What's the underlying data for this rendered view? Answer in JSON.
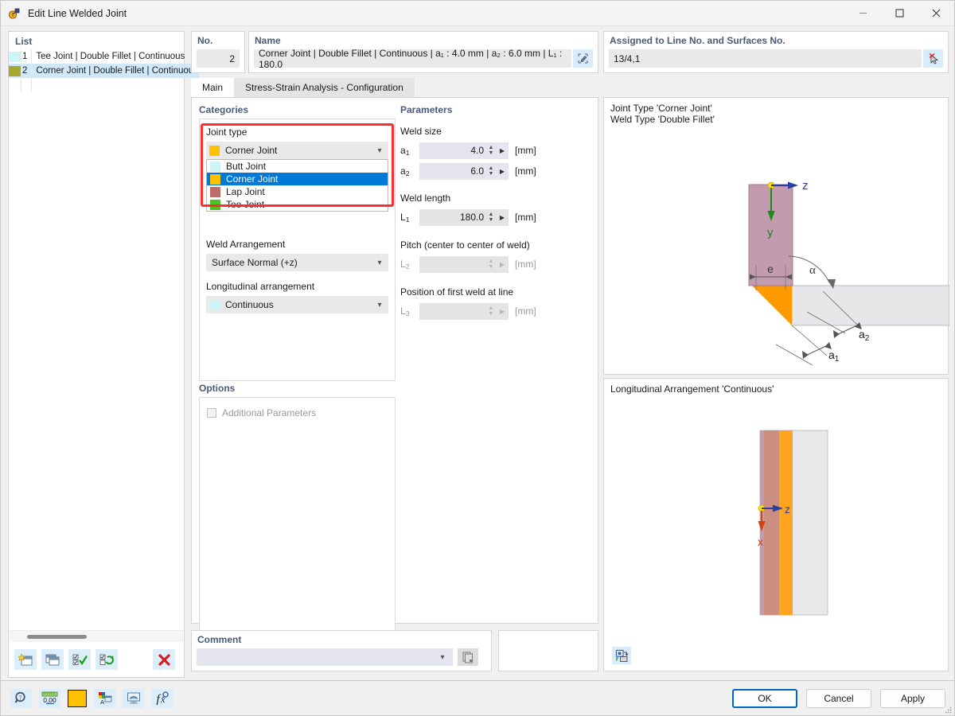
{
  "window": {
    "title": "Edit Line Welded Joint",
    "app_icon": "welded-joint-icon",
    "minimize": "–",
    "maximize": "☐",
    "close": "✕"
  },
  "list_panel": {
    "caption": "List",
    "rows": [
      {
        "color": "#cdf4f7",
        "no": "1",
        "desc": "Tee Joint | Double Fillet | Continuous",
        "selected": false
      },
      {
        "color": "#a5a82e",
        "no": "2",
        "desc": "Corner Joint | Double Fillet | Continuous",
        "selected": true
      }
    ],
    "toolbar": [
      {
        "name": "new-item-button",
        "icon": "new-window-icon"
      },
      {
        "name": "copy-item-button",
        "icon": "copy-window-icon"
      },
      {
        "name": "select-all-button",
        "icon": "check-all-icon"
      },
      {
        "name": "invert-selection-button",
        "icon": "refresh-check-icon"
      },
      {
        "name": "delete-item-button",
        "icon": "red-x-icon"
      }
    ]
  },
  "header": {
    "no_label": "No.",
    "no_value": "2",
    "name_label": "Name",
    "name_value": "Corner Joint | Double Fillet | Continuous | a₁ : 4.0 mm | a₂ : 6.0 mm | L₁ : 180.0",
    "name_edit_icon": "edit-pencil-icon",
    "assigned_label": "Assigned to Line No. and Surfaces No.",
    "assigned_value": "13/4,1",
    "assigned_pick_icon": "pick-cursor-icon"
  },
  "tabs": [
    {
      "label": "Main",
      "active": true
    },
    {
      "label": "Stress-Strain Analysis - Configuration",
      "active": false
    }
  ],
  "categories": {
    "caption": "Categories",
    "joint_type": {
      "label": "Joint type",
      "selected": "Corner Joint",
      "selected_color": "#ffc000",
      "open": true,
      "options": [
        {
          "label": "Butt Joint",
          "color": "#cdf4f7",
          "selected": false
        },
        {
          "label": "Corner Joint",
          "color": "#ffc000",
          "selected": true
        },
        {
          "label": "Lap Joint",
          "color": "#bf6b6b",
          "selected": false
        },
        {
          "label": "Tee Joint",
          "color": "#4ec12a",
          "selected": false
        }
      ]
    },
    "weld_arrangement": {
      "label": "Weld Arrangement",
      "selected": "Surface Normal (+z)"
    },
    "longitudinal_arrangement": {
      "label": "Longitudinal arrangement",
      "selected": "Continuous",
      "selected_color": "#cdf4f7"
    }
  },
  "options": {
    "caption": "Options",
    "additional_parameters_label": "Additional Parameters",
    "additional_parameters_checked": false
  },
  "parameters": {
    "caption": "Parameters",
    "groups": [
      {
        "label": "Weld size",
        "fields": [
          {
            "symbol": "a",
            "sub": "1",
            "value": "4.0",
            "unit": "[mm]",
            "enabled": true
          },
          {
            "symbol": "a",
            "sub": "2",
            "value": "6.0",
            "unit": "[mm]",
            "enabled": true
          }
        ]
      },
      {
        "label": "Weld length",
        "fields": [
          {
            "symbol": "L",
            "sub": "1",
            "value": "180.0",
            "unit": "[mm]",
            "enabled": true
          }
        ]
      },
      {
        "label": "Pitch (center to center of weld)",
        "fields": [
          {
            "symbol": "L",
            "sub": "2",
            "value": "",
            "unit": "[mm]",
            "enabled": false
          }
        ]
      },
      {
        "label": "Position of first weld at line",
        "fields": [
          {
            "symbol": "L",
            "sub": "3",
            "value": "",
            "unit": "[mm]",
            "enabled": false
          }
        ]
      }
    ]
  },
  "comment": {
    "caption": "Comment",
    "value": "",
    "copy_icon": "copy-pages-icon",
    "chevron": "⌄"
  },
  "preview_top": {
    "caption_line1": "Joint Type 'Corner Joint'",
    "caption_line2": "Weld Type 'Double Fillet'",
    "labels": {
      "axis_z": "z",
      "axis_y": "y",
      "offset_e": "e",
      "angle_alpha": "α",
      "throat_a1": "a",
      "throat_a1_sub": "1",
      "throat_a2": "a",
      "throat_a2_sub": "2"
    },
    "colors": {
      "plate_vertical": "#c49aae",
      "plate_horizontal": "#e6e6e6",
      "weld": "#ff9a00",
      "axis_z": "#2b3f9e",
      "axis_y": "#1c8a1c",
      "origin": "#ffe000"
    }
  },
  "preview_bottom": {
    "caption": "Longitudinal Arrangement 'Continuous'",
    "labels": {
      "axis_z": "z",
      "axis_x": "x"
    },
    "colors": {
      "plate": "#cc8e7e",
      "weld": "#ffa41f",
      "surface": "#e8e8ea",
      "axis_z": "#2b3f9e",
      "axis_x": "#d4400f",
      "origin": "#ffe000"
    },
    "view_button_icon": "view-toggle-icon"
  },
  "statusbar": {
    "icons": [
      {
        "name": "info-magnifier-icon"
      },
      {
        "name": "decimal-places-icon",
        "text": "0,00"
      },
      {
        "name": "color-swatch-icon",
        "color": "#ffc000"
      },
      {
        "name": "display-properties-icon"
      },
      {
        "name": "render-view-icon"
      },
      {
        "name": "formula-icon"
      }
    ],
    "buttons": [
      {
        "label": "OK",
        "default": true
      },
      {
        "label": "Cancel",
        "default": false
      },
      {
        "label": "Apply",
        "default": false
      }
    ]
  }
}
